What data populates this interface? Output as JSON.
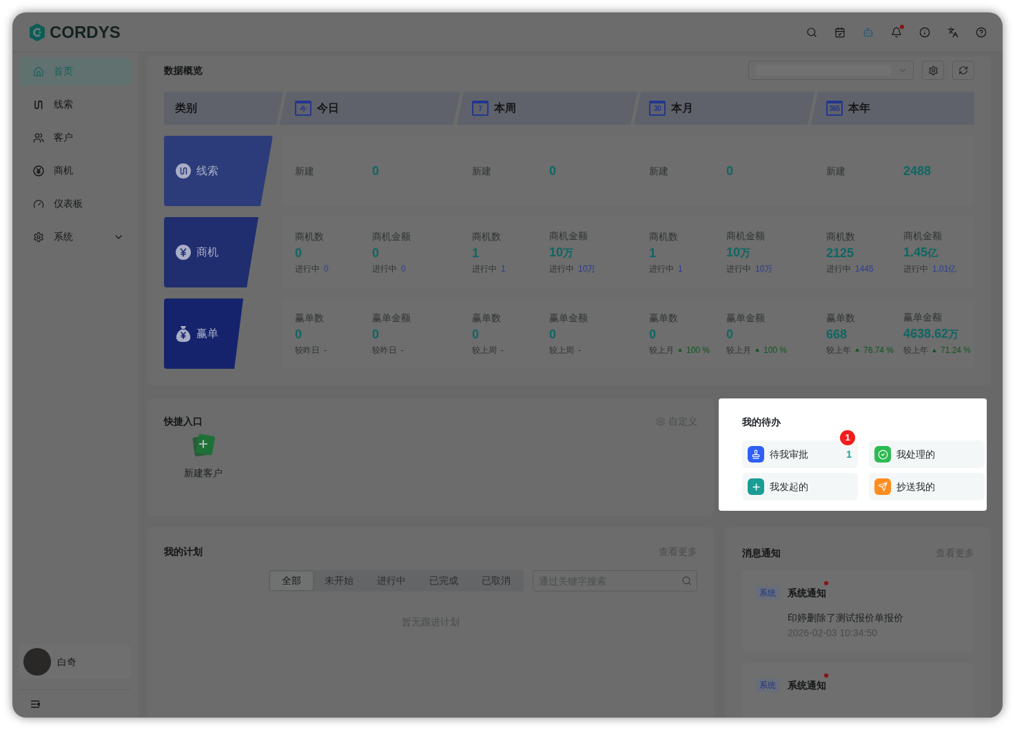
{
  "header": {
    "logo": "CORDYS",
    "bell_unread": true
  },
  "sidebar": {
    "items": [
      {
        "label": "首页",
        "kind": "link",
        "selected": true
      },
      {
        "label": "线索",
        "kind": "link",
        "selected": false
      },
      {
        "label": "客户",
        "kind": "link",
        "selected": false
      },
      {
        "label": "商机",
        "kind": "link",
        "selected": false
      },
      {
        "label": "仪表板",
        "kind": "link",
        "selected": false
      },
      {
        "label": "系统",
        "kind": "group",
        "selected": false,
        "expanded": false
      }
    ],
    "user": {
      "name": "白奇"
    }
  },
  "overview": {
    "title": "数据概览",
    "header": [
      {
        "label": "类别"
      },
      {
        "label": "今日",
        "calendar": "今"
      },
      {
        "label": "本周",
        "calendar": "7"
      },
      {
        "label": "本月",
        "calendar": "30"
      },
      {
        "label": "本年",
        "calendar": "365"
      }
    ],
    "rows": [
      {
        "category": "线索",
        "kind": "single",
        "cells": [
          {
            "label": "新建"
          },
          {
            "value": "0"
          },
          {
            "label": "新建"
          },
          {
            "value": "0"
          },
          {
            "label": "新建"
          },
          {
            "value": "0"
          },
          {
            "label": "新建"
          },
          {
            "value": "2488"
          }
        ]
      },
      {
        "category": "商机",
        "kind": "progress",
        "cells": [
          {
            "label": "商机数",
            "value": "0",
            "sub_label": "进行中",
            "sub_value": "0"
          },
          {
            "label": "商机金额",
            "value": "0",
            "sub_label": "进行中",
            "sub_value": "0"
          },
          {
            "label": "商机数",
            "value": "1",
            "sub_label": "进行中",
            "sub_value": "1"
          },
          {
            "label": "商机金额",
            "value": "10",
            "unit": "万",
            "sub_label": "进行中",
            "sub_value": "10万"
          },
          {
            "label": "商机数",
            "value": "1",
            "sub_label": "进行中",
            "sub_value": "1"
          },
          {
            "label": "商机金额",
            "value": "10",
            "unit": "万",
            "sub_label": "进行中",
            "sub_value": "10万"
          },
          {
            "label": "商机数",
            "value": "2125",
            "sub_label": "进行中",
            "sub_value": "1445"
          },
          {
            "label": "商机金额",
            "value": "1.45",
            "unit": "亿",
            "sub_label": "进行中",
            "sub_value": "1.01亿"
          }
        ]
      },
      {
        "category": "赢单",
        "kind": "compare",
        "cells": [
          {
            "label": "赢单数",
            "value": "0",
            "sub_label": "较昨日",
            "sub_value": "-"
          },
          {
            "label": "赢单金额",
            "value": "0",
            "sub_label": "较昨日",
            "sub_value": "-"
          },
          {
            "label": "赢单数",
            "value": "0",
            "sub_label": "较上周",
            "sub_value": "-"
          },
          {
            "label": "赢单金额",
            "value": "0",
            "sub_label": "较上周",
            "sub_value": "-"
          },
          {
            "label": "赢单数",
            "value": "0",
            "sub_label": "较上月",
            "rising": true,
            "sub_value": "100 %"
          },
          {
            "label": "赢单金额",
            "value": "0",
            "sub_label": "较上月",
            "rising": true,
            "sub_value": "100 %"
          },
          {
            "label": "赢单数",
            "value": "668",
            "sub_label": "较上年",
            "rising": true,
            "sub_value": "76.74 %"
          },
          {
            "label": "赢单金额",
            "value": "4638.62",
            "unit": "万",
            "sub_label": "较上年",
            "rising": true,
            "sub_value": "71.24 %"
          }
        ]
      }
    ]
  },
  "quick_entry": {
    "title": "快捷入口",
    "customize": "自定义",
    "items": [
      {
        "label": "新建客户"
      }
    ]
  },
  "todo": {
    "title": "我的待办",
    "items": [
      {
        "kind": "approval",
        "label": "待我审批",
        "count": "1",
        "badge": "1"
      },
      {
        "kind": "handled",
        "label": "我处理的"
      },
      {
        "kind": "initiated",
        "label": "我发起的"
      },
      {
        "kind": "cc",
        "label": "抄送我的"
      }
    ]
  },
  "plan": {
    "title": "我的计划",
    "more": "查看更多",
    "tabs": [
      {
        "label": "全部",
        "selected": true
      },
      {
        "label": "未开始",
        "selected": false
      },
      {
        "label": "进行中",
        "selected": false
      },
      {
        "label": "已完成",
        "selected": false
      },
      {
        "label": "已取消",
        "selected": false
      }
    ],
    "search": {
      "placeholder": "通过关键字搜索"
    },
    "empty": "暂无跟进计划"
  },
  "notifications": {
    "title": "消息通知",
    "more": "查看更多",
    "items": [
      {
        "tag": "系统",
        "title": "系统通知",
        "unread": true,
        "content": "印婷删除了测试报价单报价",
        "time": "2026-02-03 10:34:50"
      },
      {
        "tag": "系统",
        "title": "系统通知",
        "unread": true
      }
    ]
  }
}
